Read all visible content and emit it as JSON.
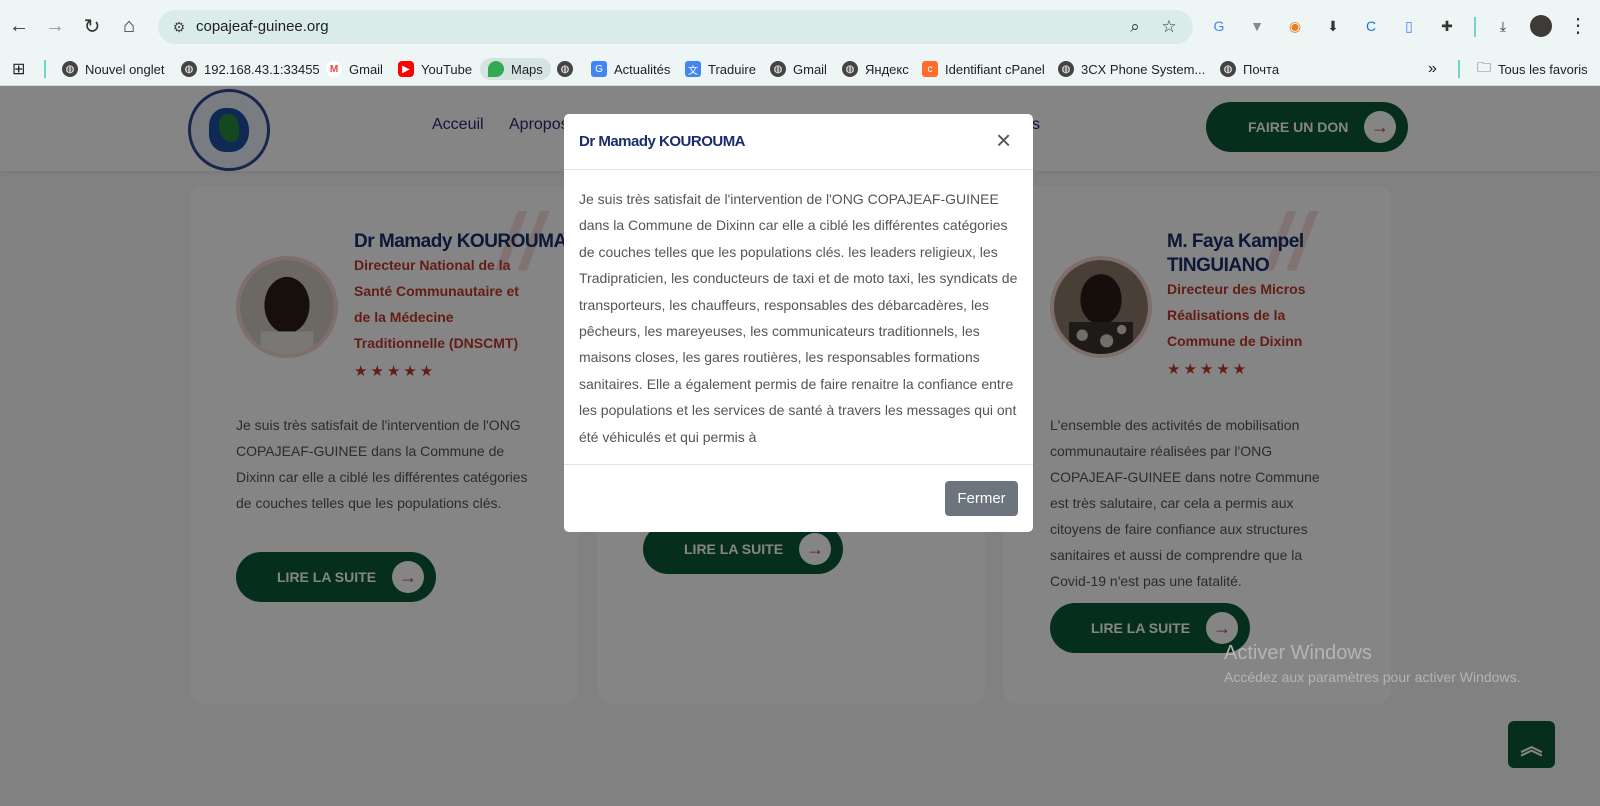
{
  "browser": {
    "url": "copajeaf-guinee.org",
    "bookmarks": [
      {
        "label": "Nouvel onglet"
      },
      {
        "label": "192.168.43.1:33455"
      },
      {
        "label": "Gmail"
      },
      {
        "label": "YouTube"
      },
      {
        "label": "Maps"
      },
      {
        "label": "Actualités"
      },
      {
        "label": "Traduire"
      },
      {
        "label": "Gmail"
      },
      {
        "label": "Яндекс"
      },
      {
        "label": "Identifiant cPanel"
      },
      {
        "label": "3CX Phone System..."
      },
      {
        "label": "Почта"
      }
    ],
    "all_bookmarks": "Tous les favoris",
    "more": "»"
  },
  "nav": {
    "items": [
      "Acceuil",
      "Apropos",
      "s"
    ],
    "donate": "FAIRE UN DON"
  },
  "cards": [
    {
      "name": "Dr Mamady KOUROUMA",
      "role": [
        "Directeur National de la",
        "Santé Communautaire et",
        "de la Médecine",
        "Traditionnelle (DNSCMT)"
      ],
      "stars": "★★★★★",
      "text": "Je suis très satisfait de l'intervention de l'ONG COPAJEAF-GUINEE dans la Commune de Dixinn car elle a ciblé les différentes catégories de couches telles que les populations clés.",
      "button": "LIRE LA SUITE"
    },
    {
      "button": "LIRE LA SUITE"
    },
    {
      "name_lines": [
        "M. Faya Kampel",
        "TINGUIANO"
      ],
      "role": [
        "Directeur des Micros",
        "Réalisations de la",
        "Commune de Dixinn"
      ],
      "stars": "★★★★★",
      "text": "L'ensemble des activités de mobilisation communautaire réalisées par l'ONG COPAJEAF-GUINEE dans notre Commune est très salutaire, car cela a permis aux citoyens de faire confiance aux structures sanitaires et aussi de comprendre que la Covid-19 n'est pas une fatalité.",
      "button": "LIRE LA SUITE"
    }
  ],
  "modal": {
    "title": "Dr Mamady KOUROUMA",
    "close_symbol": "×",
    "body": "Je suis très satisfait de l'intervention de l'ONG COPAJEAF-GUINEE dans la Commune de Dixinn car elle a ciblé les différentes catégories de couches telles que les populations clés. les leaders religieux, les Tradipraticien, les conducteurs de taxi et de moto taxi, les syndicats de transporteurs, les chauffeurs, responsables des débarcadères, les pêcheurs, les mareyeuses, les communicateurs traditionnels, les maisons closes, les gares routières, les responsables formations sanitaires. Elle a également permis de faire renaitre la confiance entre les populations et les services de santé à travers les messages qui ont été véhiculés et qui permis à",
    "close_button": "Fermer"
  },
  "windows": {
    "line1": "Activer Windows",
    "line2": "Accédez aux paramètres pour activer Windows."
  },
  "colors": {
    "brand_green": "#0b5a36",
    "accent_red": "#c0392b",
    "name_blue": "#1a2c6b"
  }
}
